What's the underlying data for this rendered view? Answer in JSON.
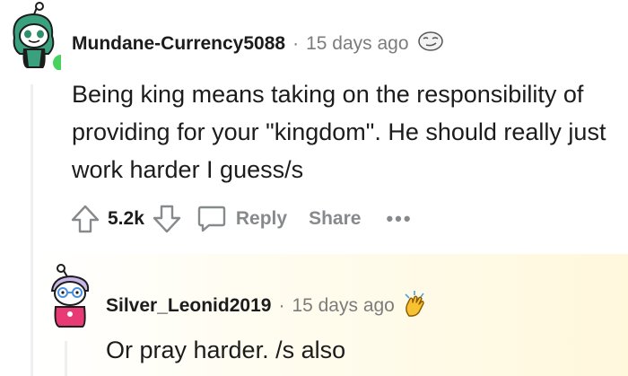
{
  "comment": {
    "username": "Mundane-Currency5088",
    "separator": "·",
    "timestamp": "15 days ago",
    "award_icon": "smirk-face-icon",
    "body": "Being king means taking on the responsibility of providing for your \"kingdom\". He should really just work harder I guess/s",
    "votes": "5.2k",
    "actions": {
      "reply_label": "Reply",
      "share_label": "Share",
      "more_label": "•••"
    }
  },
  "reply": {
    "username": "Silver_Leonid2019",
    "separator": "·",
    "timestamp": "15 days ago",
    "award_icon": "clapping-hands-icon",
    "body": "Or pray harder. /s also"
  },
  "colors": {
    "online": "#46d160",
    "meta_gray": "#7c7c7c",
    "action_gray": "#878a8c",
    "highlight": "#fff8dd"
  }
}
